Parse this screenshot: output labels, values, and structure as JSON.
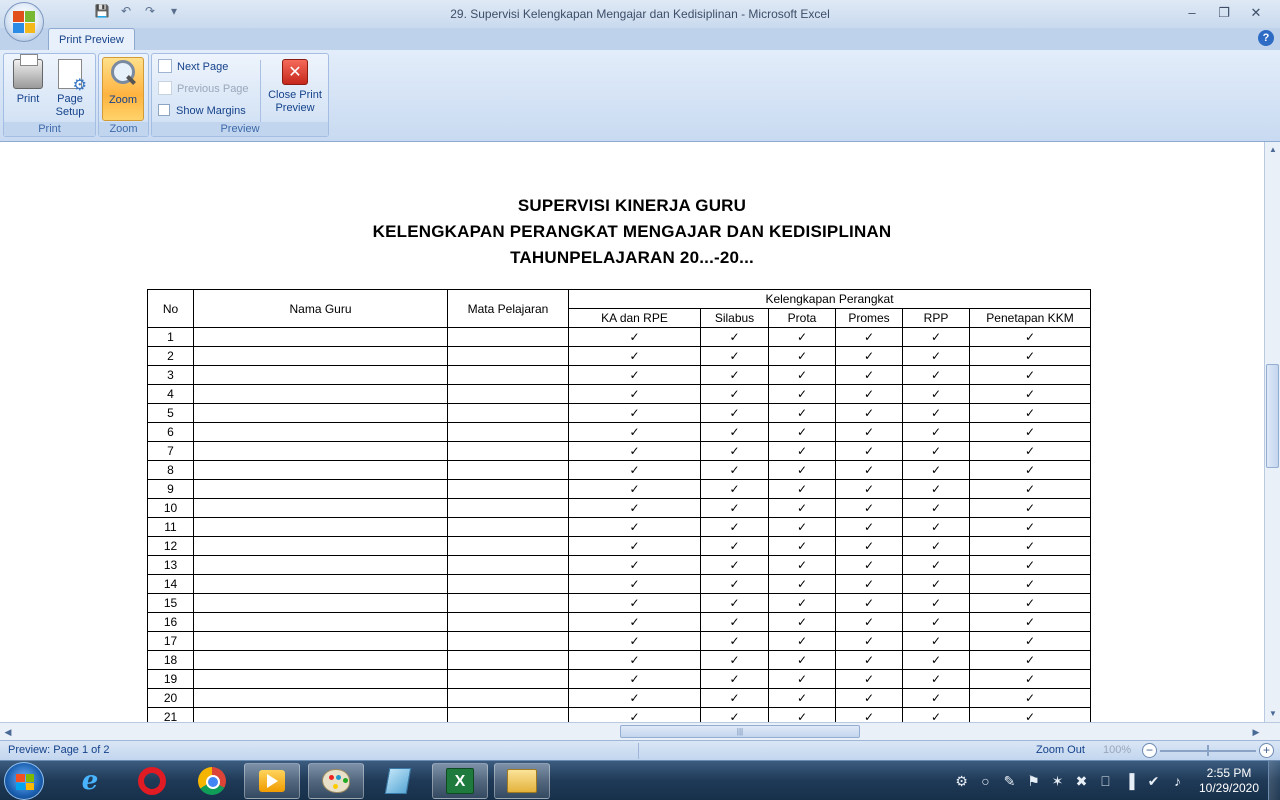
{
  "window": {
    "title": "29. Supervisi Kelengkapan Mengajar dan Kedisiplinan  -  Microsoft Excel",
    "minimize_glyph": "‒",
    "restore_glyph": "❐",
    "close_glyph": "✕"
  },
  "quick_access": {
    "save_glyph": "💾",
    "undo_glyph": "↶",
    "redo_glyph": "↷",
    "customize_glyph": "▾"
  },
  "ribbon": {
    "active_tab": "Print Preview",
    "help_glyph": "?",
    "groups": {
      "print": {
        "label": "Print",
        "print_label": "Print",
        "page_setup_label_1": "Page",
        "page_setup_label_2": "Setup"
      },
      "zoom": {
        "label": "Zoom",
        "zoom_label": "Zoom"
      },
      "preview": {
        "label": "Preview",
        "next_page": "Next Page",
        "previous_page": "Previous Page",
        "show_margins": "Show Margins",
        "close_label_1": "Close Print",
        "close_label_2": "Preview",
        "close_glyph": "✕"
      }
    }
  },
  "document": {
    "title_lines": [
      "SUPERVISI KINERJA GURU",
      "KELENGKAPAN PERANGKAT MENGAJAR DAN KEDISIPLINAN",
      "TAHUNPELAJARAN 20...-20..."
    ],
    "table": {
      "headers": {
        "no": "No",
        "nama_guru": "Nama Guru",
        "mata_pelajaran": "Mata Pelajaran",
        "group": "Kelengkapan Perangkat",
        "sub": [
          "KA dan RPE",
          "Silabus",
          "Prota",
          "Promes",
          "RPP",
          "Penetapan KKM"
        ]
      },
      "check_glyph": "✓",
      "rows": [
        "1",
        "2",
        "3",
        "4",
        "5",
        "6",
        "7",
        "8",
        "9",
        "10",
        "11",
        "12",
        "13",
        "14",
        "15",
        "16",
        "17",
        "18",
        "19",
        "20",
        "21"
      ]
    }
  },
  "status": {
    "preview": "Preview: Page 1 of 2",
    "zoom_out": "Zoom Out",
    "zoom_percent": "100%",
    "minus": "−",
    "plus": "+"
  },
  "taskbar": {
    "excel_glyph": "X",
    "ie_glyph": "e",
    "tray_icons": [
      "⚙",
      "○",
      "✎",
      "⚑",
      "✶",
      "✖",
      "⎕",
      "▐",
      "✔",
      "♪"
    ],
    "time": "2:55 PM",
    "date": "10/29/2020"
  }
}
